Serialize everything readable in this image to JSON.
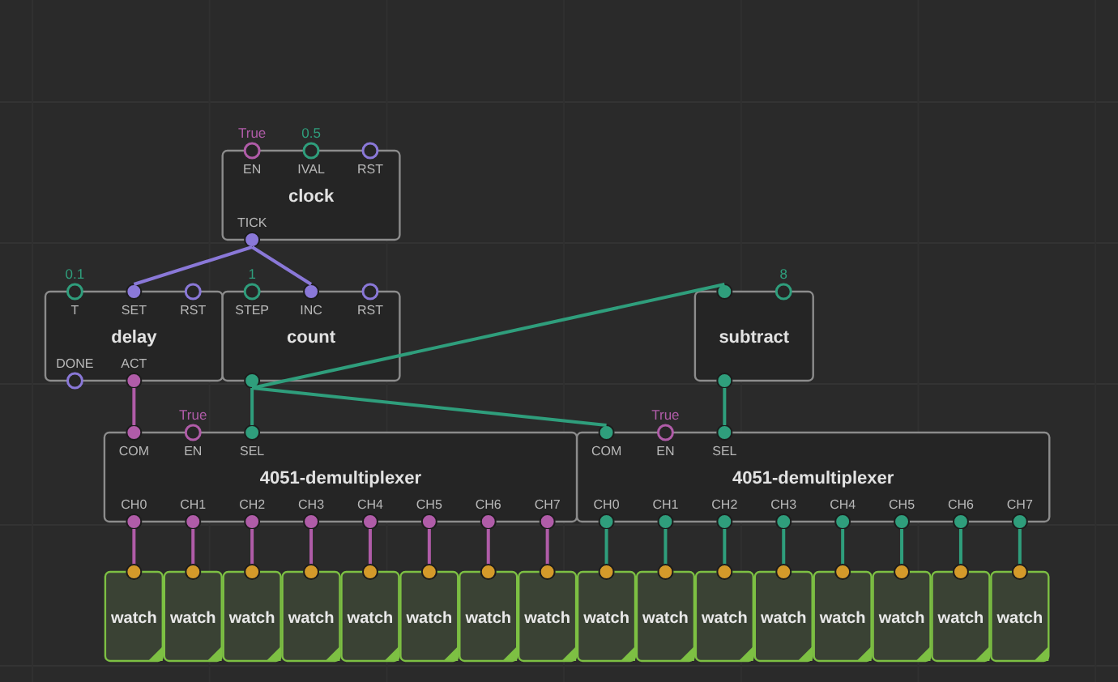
{
  "nodes": [
    {
      "title": "clock",
      "kind": "node",
      "inputs": [
        {
          "label": "EN",
          "color": "#b05ca8",
          "connected": false,
          "value": "True"
        },
        {
          "label": "IVAL",
          "color": "#2f9e7c",
          "connected": false,
          "value": "0.5"
        },
        {
          "label": "RST",
          "color": "#8a78d8",
          "connected": false
        }
      ],
      "outputs": [
        {
          "label": "TICK",
          "color": "#8a78d8",
          "connected": true
        }
      ]
    },
    {
      "title": "delay",
      "kind": "node",
      "inputs": [
        {
          "label": "T",
          "color": "#2f9e7c",
          "connected": false,
          "value": "0.1"
        },
        {
          "label": "SET",
          "color": "#8a78d8",
          "connected": true
        },
        {
          "label": "RST",
          "color": "#8a78d8",
          "connected": false
        }
      ],
      "outputs": [
        {
          "label": "DONE",
          "color": "#8a78d8",
          "connected": false
        },
        {
          "label": "ACT",
          "color": "#b05ca8",
          "connected": true
        }
      ]
    },
    {
      "title": "count",
      "kind": "node",
      "inputs": [
        {
          "label": "STEP",
          "color": "#2f9e7c",
          "connected": false,
          "value": "1"
        },
        {
          "label": "INC",
          "color": "#8a78d8",
          "connected": true
        },
        {
          "label": "RST",
          "color": "#8a78d8",
          "connected": false
        }
      ],
      "outputs": [
        {
          "color": "#2f9e7c",
          "connected": true
        }
      ]
    },
    {
      "title": "subtract",
      "kind": "node",
      "inputs": [
        {
          "color": "#2f9e7c",
          "connected": true
        },
        {
          "color": "#2f9e7c",
          "connected": false,
          "value": "8"
        }
      ],
      "outputs": [
        {
          "color": "#2f9e7c",
          "connected": true
        }
      ]
    },
    {
      "title": "4051-demultiplexer",
      "kind": "node",
      "inputs": [
        {
          "label": "COM",
          "color": "#b05ca8",
          "connected": true
        },
        {
          "label": "EN",
          "color": "#b05ca8",
          "connected": false,
          "value": "True"
        },
        {
          "label": "SEL",
          "color": "#2f9e7c",
          "connected": true
        }
      ],
      "outputs": [
        {
          "label": "CH0",
          "color": "#b05ca8",
          "connected": true
        },
        {
          "label": "CH1",
          "color": "#b05ca8",
          "connected": true
        },
        {
          "label": "CH2",
          "color": "#b05ca8",
          "connected": true
        },
        {
          "label": "CH3",
          "color": "#b05ca8",
          "connected": true
        },
        {
          "label": "CH4",
          "color": "#b05ca8",
          "connected": true
        },
        {
          "label": "CH5",
          "color": "#b05ca8",
          "connected": true
        },
        {
          "label": "CH6",
          "color": "#b05ca8",
          "connected": true
        },
        {
          "label": "CH7",
          "color": "#b05ca8",
          "connected": true
        }
      ]
    },
    {
      "title": "4051-demultiplexer",
      "kind": "node",
      "inputs": [
        {
          "label": "COM",
          "color": "#2f9e7c",
          "connected": true
        },
        {
          "label": "EN",
          "color": "#b05ca8",
          "connected": false,
          "value": "True"
        },
        {
          "label": "SEL",
          "color": "#2f9e7c",
          "connected": true
        }
      ],
      "outputs": [
        {
          "label": "CH0",
          "color": "#2f9e7c",
          "connected": true
        },
        {
          "label": "CH1",
          "color": "#2f9e7c",
          "connected": true
        },
        {
          "label": "CH2",
          "color": "#2f9e7c",
          "connected": true
        },
        {
          "label": "CH3",
          "color": "#2f9e7c",
          "connected": true
        },
        {
          "label": "CH4",
          "color": "#2f9e7c",
          "connected": true
        },
        {
          "label": "CH5",
          "color": "#2f9e7c",
          "connected": true
        },
        {
          "label": "CH6",
          "color": "#2f9e7c",
          "connected": true
        },
        {
          "label": "CH7",
          "color": "#2f9e7c",
          "connected": true
        }
      ]
    },
    {
      "title": "watch",
      "kind": "watch",
      "inputs": [
        {
          "color": "#d49a2a",
          "connected": true
        }
      ]
    },
    {
      "title": "watch",
      "kind": "watch",
      "inputs": [
        {
          "color": "#d49a2a",
          "connected": true
        }
      ]
    },
    {
      "title": "watch",
      "kind": "watch",
      "inputs": [
        {
          "color": "#d49a2a",
          "connected": true
        }
      ]
    },
    {
      "title": "watch",
      "kind": "watch",
      "inputs": [
        {
          "color": "#d49a2a",
          "connected": true
        }
      ]
    },
    {
      "title": "watch",
      "kind": "watch",
      "inputs": [
        {
          "color": "#d49a2a",
          "connected": true
        }
      ]
    },
    {
      "title": "watch",
      "kind": "watch",
      "inputs": [
        {
          "color": "#d49a2a",
          "connected": true
        }
      ]
    },
    {
      "title": "watch",
      "kind": "watch",
      "inputs": [
        {
          "color": "#d49a2a",
          "connected": true
        }
      ]
    },
    {
      "title": "watch",
      "kind": "watch",
      "inputs": [
        {
          "color": "#d49a2a",
          "connected": true
        }
      ]
    },
    {
      "title": "watch",
      "kind": "watch",
      "inputs": [
        {
          "color": "#d49a2a",
          "connected": true
        }
      ]
    },
    {
      "title": "watch",
      "kind": "watch",
      "inputs": [
        {
          "color": "#d49a2a",
          "connected": true
        }
      ]
    },
    {
      "title": "watch",
      "kind": "watch",
      "inputs": [
        {
          "color": "#d49a2a",
          "connected": true
        }
      ]
    },
    {
      "title": "watch",
      "kind": "watch",
      "inputs": [
        {
          "color": "#d49a2a",
          "connected": true
        }
      ]
    },
    {
      "title": "watch",
      "kind": "watch",
      "inputs": [
        {
          "color": "#d49a2a",
          "connected": true
        }
      ]
    },
    {
      "title": "watch",
      "kind": "watch",
      "inputs": [
        {
          "color": "#d49a2a",
          "connected": true
        }
      ]
    },
    {
      "title": "watch",
      "kind": "watch",
      "inputs": [
        {
          "color": "#d49a2a",
          "connected": true
        }
      ]
    },
    {
      "title": "watch",
      "kind": "watch",
      "inputs": [
        {
          "color": "#d49a2a",
          "connected": true
        }
      ]
    }
  ]
}
